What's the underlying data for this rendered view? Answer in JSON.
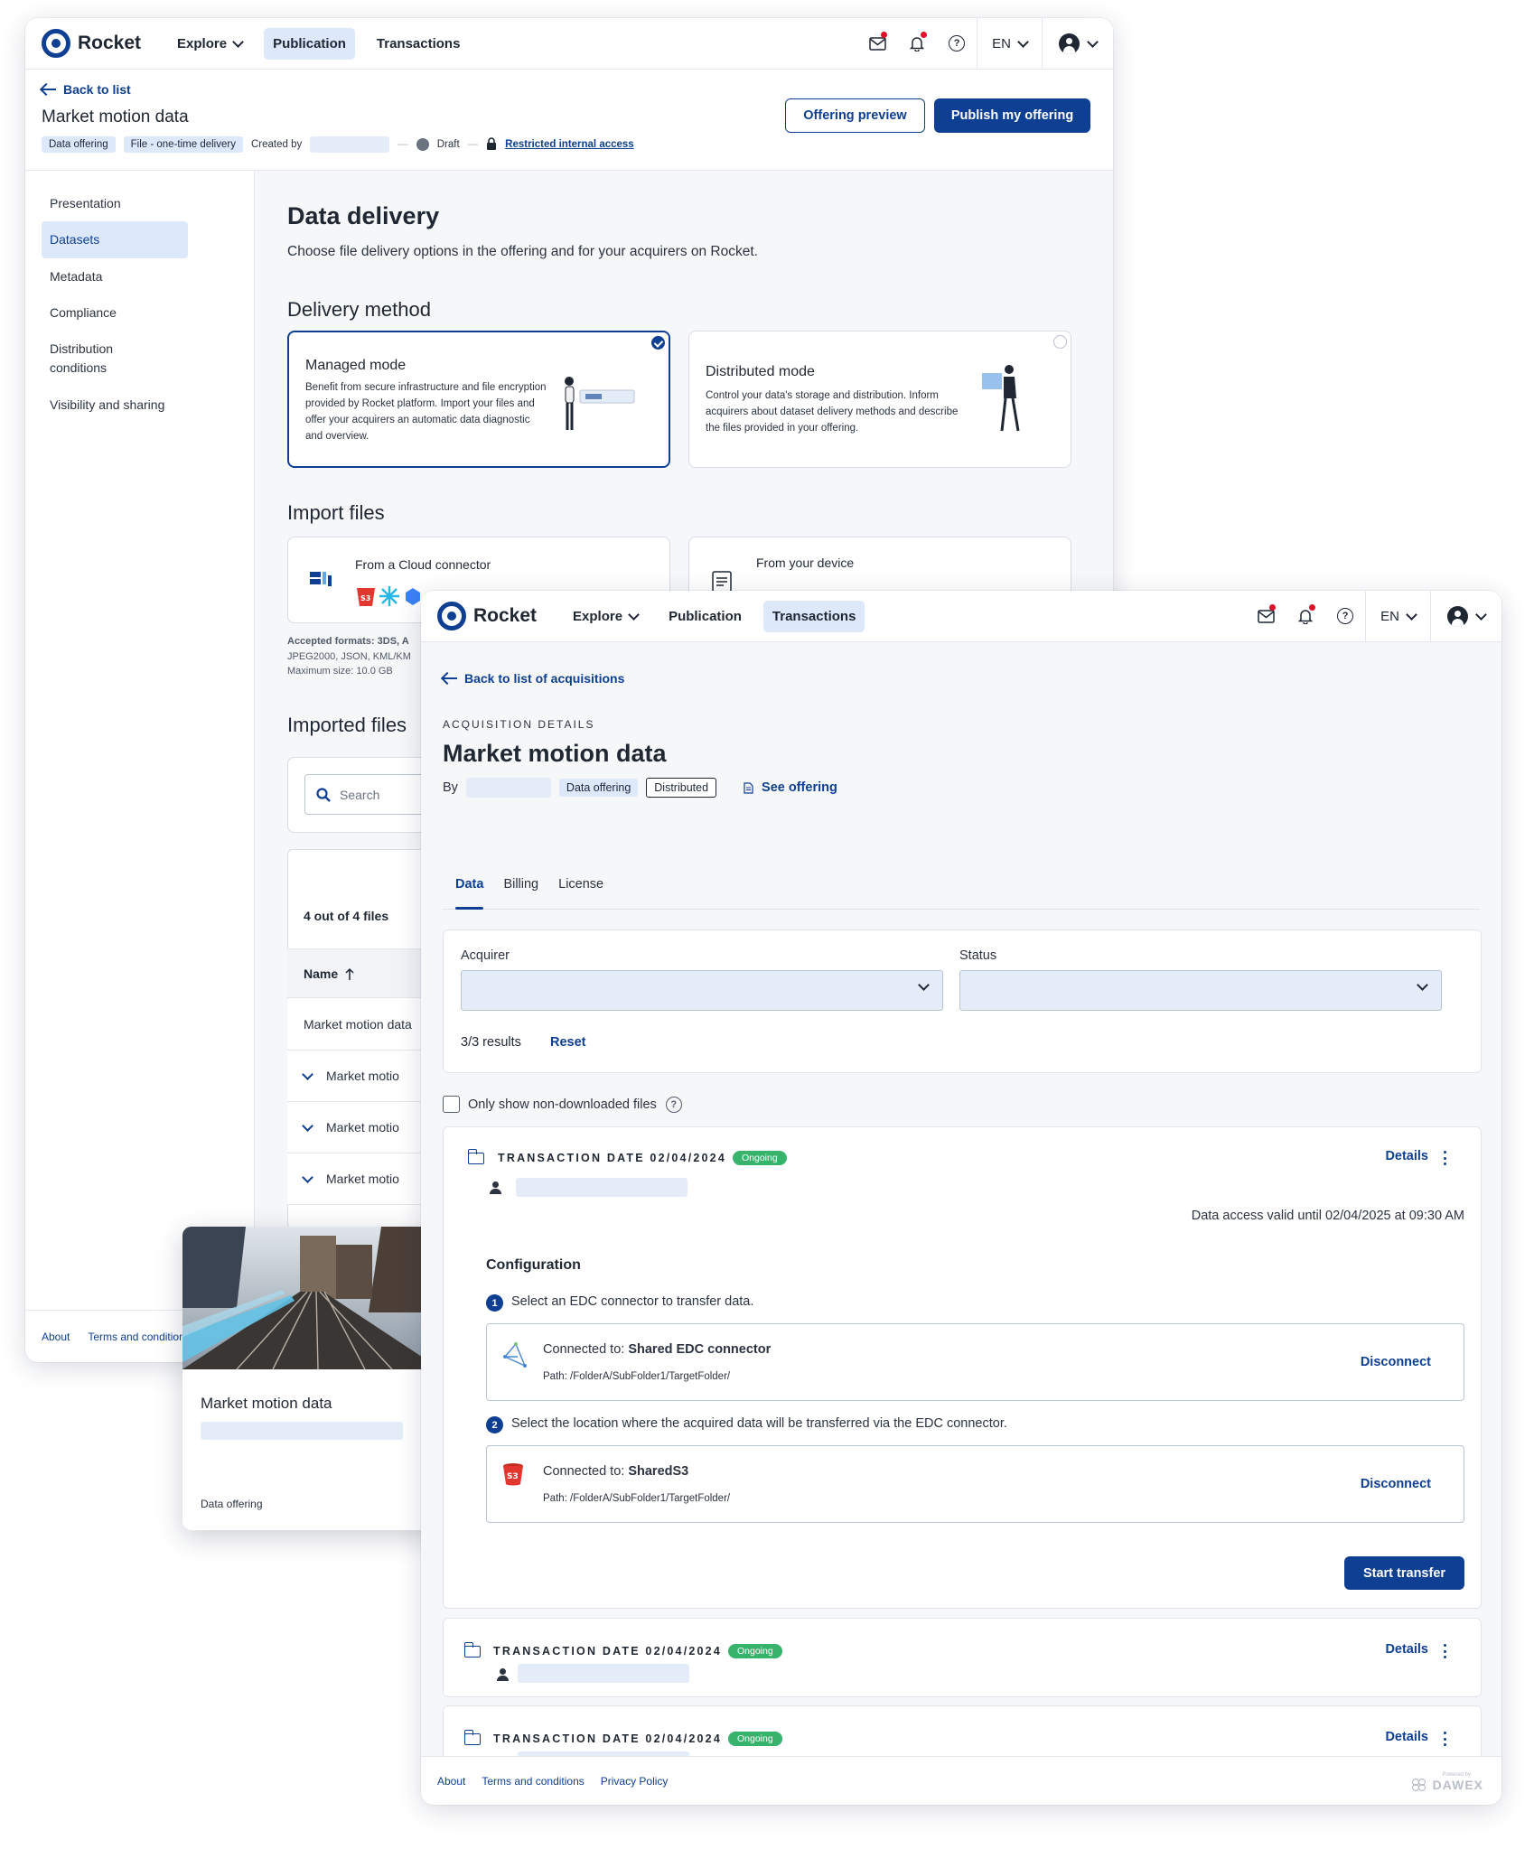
{
  "brand": {
    "name": "Rocket",
    "color": "#0e3f92"
  },
  "back_window": {
    "nav": {
      "explore": "Explore",
      "publication": "Publication",
      "transactions": "Transactions",
      "lang": "EN"
    },
    "back_link": "Back to list",
    "title": "Market motion data",
    "chips": {
      "type": "Data offering",
      "delivery": "File - one-time delivery",
      "created_by": "Created by",
      "status": "Draft",
      "access": "Restricted internal access"
    },
    "buttons": {
      "preview": "Offering preview",
      "publish": "Publish my offering"
    },
    "sidebar": {
      "items": [
        "Presentation",
        "Datasets",
        "Metadata",
        "Compliance",
        "Distribution conditions",
        "Visibility and sharing"
      ],
      "active": "Datasets",
      "footer": [
        "About",
        "Terms and conditions"
      ]
    },
    "section": {
      "title": "Data delivery",
      "subtitle": "Choose file delivery options in the offering and for your acquirers on Rocket.",
      "delivery_method": "Delivery method",
      "managed": {
        "title": "Managed mode",
        "text": "Benefit from secure infrastructure and file encryption provided by Rocket platform. Import your files and offer your acquirers an automatic data diagnostic and overview."
      },
      "distributed": {
        "title": "Distributed mode",
        "text": "Control your data's storage and distribution. Inform acquirers about dataset delivery methods and describe the files provided in your offering."
      },
      "import_files": "Import files",
      "cloud": "From a Cloud connector",
      "device": "From your device",
      "accepted": "Accepted formats: 3DS, A",
      "accepted2": "JPEG2000, JSON, KML/KM",
      "max_size": "Maximum size: 10.0 GB",
      "imported_files": "Imported files",
      "search_placeholder": "Search",
      "count": "4 out of 4 files",
      "name_col": "Name",
      "rows": [
        "Market motion data",
        "Market motio",
        "Market motio",
        "Market motio"
      ]
    }
  },
  "float_card": {
    "title": "Market motion data",
    "type": "Data offering"
  },
  "front_window": {
    "nav": {
      "explore": "Explore",
      "publication": "Publication",
      "transactions": "Transactions",
      "lang": "EN"
    },
    "back_link": "Back to list of acquisitions",
    "eyebrow": "ACQUISITION DETAILS",
    "title": "Market motion data",
    "by": "By",
    "chips": {
      "type": "Data offering",
      "mode": "Distributed"
    },
    "see_offering": "See offering",
    "tabs": [
      "Data",
      "Billing",
      "License"
    ],
    "active_tab": "Data",
    "filters": {
      "acquirer": "Acquirer",
      "status": "Status",
      "results": "3/3 results",
      "reset": "Reset"
    },
    "only_non_downloaded": "Only show non-downloaded files",
    "transactions": [
      {
        "label": "TRANSACTION DATE 02/04/2024",
        "badge": "Ongoing",
        "details": "Details"
      },
      {
        "label": "TRANSACTION DATE 02/04/2024",
        "badge": "Ongoing",
        "details": "Details"
      },
      {
        "label": "TRANSACTION DATE 02/04/2024",
        "badge": "Ongoing",
        "details": "Details"
      }
    ],
    "access_valid": "Data access valid until 02/04/2025 at 09:30 AM",
    "configuration": {
      "title": "Configuration",
      "step1": "Select an EDC connector to transfer data.",
      "step2": "Select the location where the acquired data will be transferred via the EDC connector.",
      "connected_prefix": "Connected to:",
      "connector1": "Shared EDC connector",
      "connector2": "SharedS3",
      "path": "Path: /FolderA/SubFolder1/TargetFolder/",
      "disconnect": "Disconnect",
      "start": "Start transfer"
    },
    "footer": [
      "About",
      "Terms and conditions",
      "Privacy Policy"
    ],
    "powered": {
      "label": "Powered by",
      "brand": "DAWEX"
    }
  },
  "colors": {
    "accent": "#0e3f92",
    "chip_bg": "#dde9fb",
    "ongoing": "#37b36c",
    "notify": "#e0102a"
  }
}
